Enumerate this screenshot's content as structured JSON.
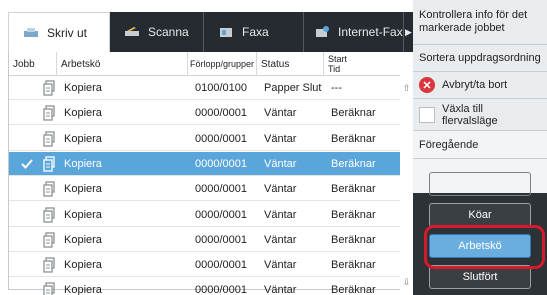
{
  "tabs": [
    {
      "label": "Skriv ut",
      "icon": "printer-icon",
      "active": true
    },
    {
      "label": "Scanna",
      "icon": "scanner-icon",
      "active": false
    },
    {
      "label": "Faxa",
      "icon": "fax-icon",
      "active": false
    },
    {
      "label": "Internet-Fax",
      "icon": "internet-fax-icon",
      "active": false
    }
  ],
  "more_tabs_icon": "chevron-right-icon",
  "table": {
    "headers": {
      "job": "Jobb",
      "workflow": "Arbetskö",
      "progress": "Förlopp/grupper",
      "status": "Status",
      "start_time_line1": "Start",
      "start_time_line2": "Tid"
    },
    "rows": [
      {
        "workflow": "Kopiera",
        "progress": "0100/0100",
        "status": "Papper Slut",
        "start": "---",
        "selected": false
      },
      {
        "workflow": "Kopiera",
        "progress": "0000/0001",
        "status": "Väntar",
        "start": "Beräknar",
        "selected": false
      },
      {
        "workflow": "Kopiera",
        "progress": "0000/0001",
        "status": "Väntar",
        "start": "Beräknar",
        "selected": false
      },
      {
        "workflow": "Kopiera",
        "progress": "0000/0001",
        "status": "Väntar",
        "start": "Beräknar",
        "selected": true
      },
      {
        "workflow": "Kopiera",
        "progress": "0000/0001",
        "status": "Väntar",
        "start": "Beräknar",
        "selected": false
      },
      {
        "workflow": "Kopiera",
        "progress": "0000/0001",
        "status": "Väntar",
        "start": "Beräknar",
        "selected": false
      },
      {
        "workflow": "Kopiera",
        "progress": "0000/0001",
        "status": "Väntar",
        "start": "Beräknar",
        "selected": false
      },
      {
        "workflow": "Kopiera",
        "progress": "0000/0001",
        "status": "Väntar",
        "start": "Beräknar",
        "selected": false
      },
      {
        "workflow": "Kopiera",
        "progress": "0000/0001",
        "status": "Väntar",
        "start": "Beräknar",
        "selected": false
      }
    ]
  },
  "side_menu": {
    "check_info": "Kontrollera info för det markerade jobbet",
    "sort_order": "Sortera uppdragsordning",
    "cancel_delete": "Avbryt/ta bort",
    "switch_priority": "Växla till flervalsläge",
    "previous": "Föregående"
  },
  "buttons": {
    "queue": "Köar",
    "job_queue": "Arbetskö",
    "finished": "Slutfört"
  },
  "colors": {
    "selected_row": "#5aa6db",
    "highlight": "#d7192a",
    "panel": "#2d3237"
  }
}
